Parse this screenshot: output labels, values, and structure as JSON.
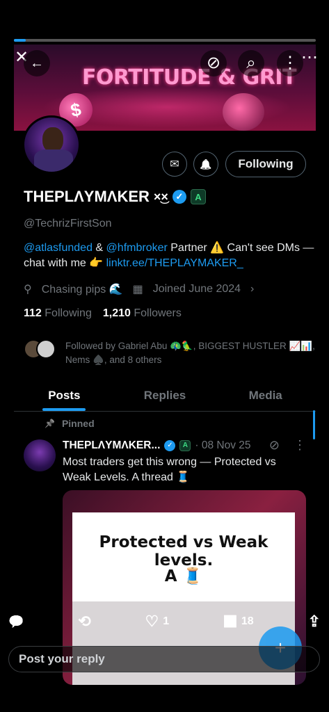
{
  "story": {
    "progress_percent": 4
  },
  "top_bar": {
    "close_icon": "close-icon",
    "back_icon": "back-arrow-icon",
    "grok_icon": "grok-icon",
    "search_icon": "search-icon",
    "more_icon": "more-vertical-icon",
    "overflow_icon": "more-horizontal-icon",
    "close_glyph": "✕",
    "back_glyph": "←",
    "grok_glyph": "⊘",
    "search_glyph": "⌕",
    "more_glyph": "⋮",
    "overflow_glyph": "⋯"
  },
  "banner": {
    "title": "FORTITUDE & GRIT",
    "coin_glyph": "$"
  },
  "profile": {
    "name": "THEPLΛYMΛKER",
    "name_suffix": "×͜×",
    "verified_glyph": "✓",
    "affiliate_badge": "A",
    "handle": "@TechrizFirstSon",
    "bio_mention_1": "@atlasfunded",
    "bio_amp": " & ",
    "bio_mention_2": "@hfmbroker",
    "bio_text_1": " Partner ⚠️ Can't see DMs — chat with me 👉 ",
    "bio_link": "linktr.ee/THEPLAYMAKER_",
    "location": "Chasing pips 🌊",
    "joined": "Joined June 2024",
    "following_count": "112",
    "following_label": "Following",
    "followers_count": "1,210",
    "followers_label": "Followers",
    "followed_by": "Followed by Gabriel Abu 🦚🦜, BIGGEST HUSTLER 📈📊, Nems ♠️, and 8 others"
  },
  "buttons": {
    "message_glyph": "✉",
    "notify_glyph": "🔔",
    "following_label": "Following"
  },
  "tabs": [
    {
      "label": "Posts",
      "active": true
    },
    {
      "label": "Replies",
      "active": false
    },
    {
      "label": "Media",
      "active": false
    }
  ],
  "post": {
    "pinned_glyph": "📌",
    "pinned_label": "Pinned",
    "author": "THEPLΛYMΛKER...",
    "verified_glyph": "✓",
    "affiliate_badge": "A",
    "date": "· 08 Nov 25",
    "grok_glyph": "⊘",
    "more_glyph": "⋮",
    "text": "Most traders get this wrong — Protected vs Weak Levels. A thread 🧵",
    "media_title": "Protected vs Weak levels.",
    "media_sub": "A 🧵"
  },
  "actions": {
    "reply_glyph": "💬",
    "repost_glyph": "⟲",
    "like_glyph": "♡",
    "like_count": "1",
    "views_glyph": "📊",
    "views_count": "18",
    "share_glyph": "⇪"
  },
  "compose": {
    "fab_glyph": "+",
    "reply_placeholder": "Post your reply"
  },
  "colors": {
    "accent": "#1d9bf0",
    "background": "#000000",
    "muted": "#71767b"
  }
}
